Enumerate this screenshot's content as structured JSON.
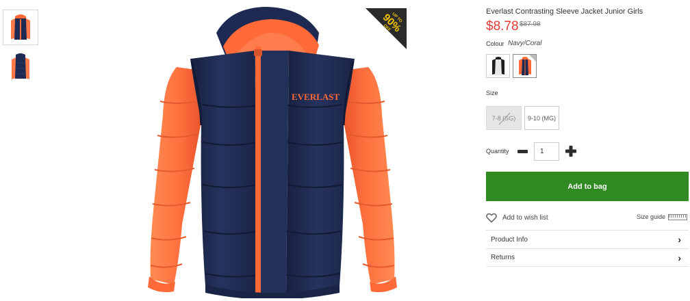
{
  "product": {
    "title": "Everlast Contrasting Sleeve Jacket Junior Girls",
    "price": "$8.78",
    "was_price": "$87.98",
    "badge": {
      "top": "UP TO",
      "big": "90%",
      "bottom": "OFF"
    },
    "logo_text": "EVERLAST"
  },
  "colour": {
    "label": "Colour",
    "value": "Navy/Coral",
    "swatches": [
      {
        "name": "Black/White",
        "selected": false
      },
      {
        "name": "Navy/Coral",
        "selected": true
      }
    ]
  },
  "size": {
    "label": "Size",
    "options": [
      {
        "label": "7-8 (SG)",
        "available": false
      },
      {
        "label": "9-10 (MG)",
        "available": true
      }
    ]
  },
  "quantity": {
    "label": "Quantity",
    "value": "1"
  },
  "actions": {
    "add_to_bag": "Add to bag",
    "wish_list": "Add to wish list",
    "size_guide": "Size guide"
  },
  "accordion": [
    {
      "label": "Product Info"
    },
    {
      "label": "Returns"
    }
  ],
  "colors": {
    "price_red": "#e53935",
    "add_to_bag_green": "#2f8a22",
    "navy": "#1f2a52",
    "coral": "#ff6a38",
    "badge_bg": "#2a2a2a",
    "badge_text": "#f5c400"
  },
  "icons": [
    "minus-icon",
    "plus-icon",
    "heart-icon",
    "chevron-right-icon",
    "ruler-icon"
  ]
}
